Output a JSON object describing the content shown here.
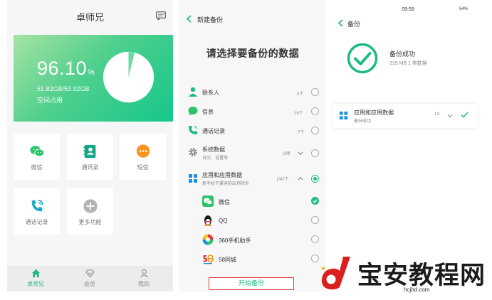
{
  "panel1": {
    "title": "卓师兄",
    "hero": {
      "percent_value": "96.10",
      "percent_unit": "%",
      "percent": 96.1,
      "size": "51.82GB/53.92GB",
      "used_label": "空间占用"
    },
    "tiles": [
      {
        "label": "微信",
        "icon": "wechat-icon"
      },
      {
        "label": "通讯录",
        "icon": "contacts-book-icon"
      },
      {
        "label": "短信",
        "icon": "sms-icon"
      },
      {
        "label": "通话记录",
        "icon": "call-log-icon"
      },
      {
        "label": "更多功能",
        "icon": "plus-icon"
      }
    ],
    "nav": [
      {
        "label": "卓师兄",
        "icon": "home-icon",
        "active": true
      },
      {
        "label": "会员",
        "icon": "vip-icon",
        "active": false
      },
      {
        "label": "我的",
        "icon": "user-icon",
        "active": false
      }
    ]
  },
  "panel2": {
    "title": "新建备份",
    "heading": "请选择要备份的数据",
    "rows": [
      {
        "title": "联系人",
        "count": "0个",
        "state": "unchecked",
        "icon": "contact-icon"
      },
      {
        "title": "信息",
        "count": "19个",
        "state": "unchecked",
        "icon": "message-icon"
      },
      {
        "title": "通话记录",
        "count": "7个",
        "state": "unchecked",
        "icon": "phone-icon"
      },
      {
        "title": "系统数据",
        "subtitle": "日历、设置等",
        "count": "8项",
        "state": "unchecked",
        "icon": "gear-icon"
      },
      {
        "title": "应用和应用数据",
        "subtitle": "新手机不兼容的应用除外",
        "count": "1/47个",
        "state": "partial",
        "icon": "apps-icon"
      }
    ],
    "apps": [
      {
        "name": "微信",
        "state": "checked",
        "icon": "wechat-app-icon"
      },
      {
        "name": "QQ",
        "state": "unchecked",
        "icon": "qq-penguin-icon"
      },
      {
        "name": "360手机助手",
        "state": "unchecked",
        "icon": "360-assistant-icon"
      },
      {
        "name": "58同城",
        "state": "unchecked",
        "icon": "58-city-icon"
      }
    ],
    "start_button": "开始备份"
  },
  "panel3": {
    "time": "09:59",
    "battery": "54%",
    "title": "备份",
    "status": "备份成功",
    "meta": "319 MB  1 类数据",
    "card": {
      "title": "应用和应用数据",
      "subtitle": "备份成功",
      "count": "1/1"
    }
  },
  "watermark": {
    "text": "宝安教程网",
    "url": "hcjhd.com"
  },
  "colors": {
    "accent": "#1fb985",
    "hero_start": "#a6e3a3",
    "hero_end": "#15c78b",
    "highlight": "#e23b3b"
  }
}
